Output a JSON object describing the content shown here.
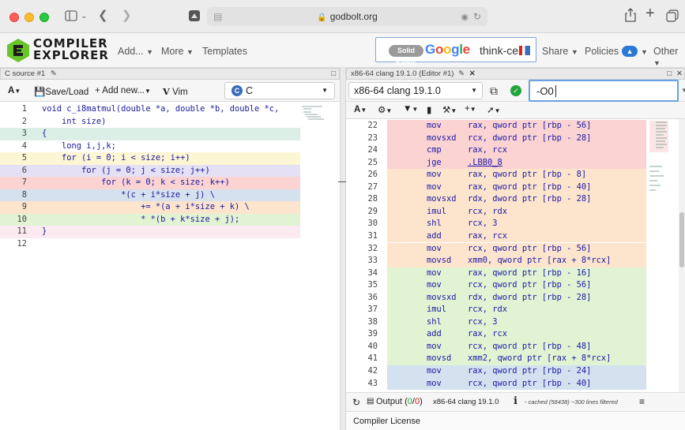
{
  "browser": {
    "url": "godbolt.org",
    "icons": [
      "sidebar-icon",
      "back-icon",
      "forward-icon",
      "lock-icon",
      "share-icon",
      "new-tab-icon",
      "tabs-icon"
    ]
  },
  "site": {
    "brand_line1": "COMPILER",
    "brand_line2": "EXPLORER",
    "nav": {
      "add": "Add...",
      "more": "More",
      "templates": "Templates"
    },
    "sponsors": {
      "solid": "Solid Sands",
      "google": "Google",
      "thinkcell": "think-cell"
    },
    "right_nav": {
      "share": "Share",
      "policies": "Policies",
      "policies_badge": "▲",
      "other": "Other"
    },
    "colors": {
      "google": [
        "#4285F4",
        "#EA4335",
        "#FBBC05",
        "#4285F4",
        "#34A853",
        "#EA4335"
      ]
    }
  },
  "source": {
    "tab": "C source #1",
    "toolbar": {
      "font": "A",
      "save": "Save/Load",
      "add_new": "+ Add new...",
      "vim": "Vim",
      "language": "C"
    },
    "lines": [
      {
        "n": "1",
        "text": "void c_i8matmul(double *a, double *b, double *c,",
        "bg": "#ffffff"
      },
      {
        "n": "2",
        "text": "    int size)",
        "bg": "#ffffff"
      },
      {
        "n": "3",
        "text": "{",
        "bg": "#dbefe7"
      },
      {
        "n": "4",
        "text": "    long i,j,k;",
        "bg": "#ffffff"
      },
      {
        "n": "5",
        "text": "    for (i = 0; i < size; i++)",
        "bg": "#fdf6d5"
      },
      {
        "n": "6",
        "text": "        for (j = 0; j < size; j++)",
        "bg": "#e5e0f3"
      },
      {
        "n": "7",
        "text": "            for (k = 0; k < size; k++)",
        "bg": "#fbd3d3"
      },
      {
        "n": "8",
        "text": "                *(c + i*size + j) \\",
        "bg": "#d4e1ee"
      },
      {
        "n": "9",
        "text": "                    += *(a + i*size + k) \\",
        "bg": "#fde4cd"
      },
      {
        "n": "10",
        "text": "                    * *(b + k*size + j);",
        "bg": "#e2f3d3"
      },
      {
        "n": "11",
        "text": "}",
        "bg": "#fbeaf0"
      },
      {
        "n": "12",
        "text": "",
        "bg": "#ffffff"
      }
    ]
  },
  "asm": {
    "tab": "x86-64 clang 19.1.0 (Editor #1)",
    "compiler": "x86-64 clang 19.1.0",
    "options": "-O0",
    "lines": [
      {
        "n": "22",
        "op": "mov",
        "args": "rax, qword ptr [rbp - 56]",
        "bg": "#fbd3d3"
      },
      {
        "n": "23",
        "op": "movsxd",
        "args": "rcx, dword ptr [rbp - 28]",
        "bg": "#fbd3d3"
      },
      {
        "n": "24",
        "op": "cmp",
        "args": "rax, rcx",
        "bg": "#fbd3d3"
      },
      {
        "n": "25",
        "op": "jge",
        "args": ".LBB0_8",
        "bg": "#fbd3d3",
        "label": true
      },
      {
        "n": "26",
        "op": "mov",
        "args": "rax, qword ptr [rbp - 8]",
        "bg": "#fde4cd"
      },
      {
        "n": "27",
        "op": "mov",
        "args": "rax, qword ptr [rbp - 40]",
        "bg": "#fde4cd"
      },
      {
        "n": "28",
        "op": "movsxd",
        "args": "rdx, dword ptr [rbp - 28]",
        "bg": "#fde4cd"
      },
      {
        "n": "29",
        "op": "imul",
        "args": "rcx, rdx",
        "bg": "#fde4cd"
      },
      {
        "n": "30",
        "op": "shl",
        "args": "rcx, 3",
        "bg": "#fde4cd"
      },
      {
        "n": "31",
        "op": "add",
        "args": "rax, rcx",
        "bg": "#fde4cd"
      },
      {
        "n": "32",
        "op": "mov",
        "args": "rcx, qword ptr [rbp - 56]",
        "bg": "#fde4cd"
      },
      {
        "n": "33",
        "op": "movsd",
        "args": "xmm0, qword ptr [rax + 8*rcx]",
        "bg": "#fde4cd"
      },
      {
        "n": "34",
        "op": "mov",
        "args": "rax, qword ptr [rbp - 16]",
        "bg": "#e2f3d3"
      },
      {
        "n": "35",
        "op": "mov",
        "args": "rcx, qword ptr [rbp - 56]",
        "bg": "#e2f3d3"
      },
      {
        "n": "36",
        "op": "movsxd",
        "args": "rdx, dword ptr [rbp - 28]",
        "bg": "#e2f3d3"
      },
      {
        "n": "37",
        "op": "imul",
        "args": "rcx, rdx",
        "bg": "#e2f3d3"
      },
      {
        "n": "38",
        "op": "shl",
        "args": "rcx, 3",
        "bg": "#e2f3d3"
      },
      {
        "n": "39",
        "op": "add",
        "args": "rax, rcx",
        "bg": "#e2f3d3"
      },
      {
        "n": "40",
        "op": "mov",
        "args": "rcx, qword ptr [rbp - 48]",
        "bg": "#e2f3d3"
      },
      {
        "n": "41",
        "op": "movsd",
        "args": "xmm2, qword ptr [rax + 8*rcx]",
        "bg": "#e2f3d3"
      },
      {
        "n": "42",
        "op": "mov",
        "args": "rax, qword ptr [rbp - 24]",
        "bg": "#d4e1ee"
      },
      {
        "n": "43",
        "op": "mov",
        "args": "rcx, qword ptr [rbp - 40]",
        "bg": "#d4e1ee"
      }
    ],
    "output": {
      "label": "Output",
      "open": "(",
      "count_ok": "0",
      "slash": "/",
      "count_err": "0",
      "close": ")",
      "compiler": "x86-64 clang 19.1.0",
      "info": "i",
      "cached": "- cached (58438) ~300 lines filtered"
    },
    "license": "Compiler License"
  }
}
